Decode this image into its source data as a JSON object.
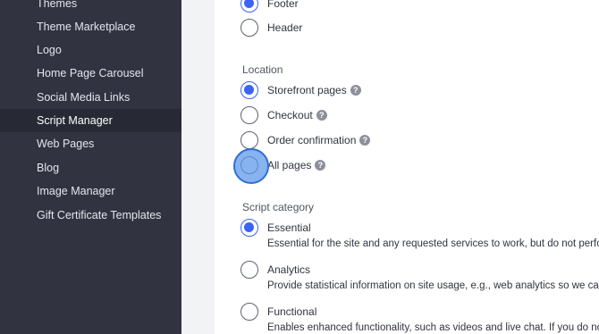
{
  "sidebar": {
    "items": [
      {
        "label": "Themes"
      },
      {
        "label": "Theme Marketplace"
      },
      {
        "label": "Logo"
      },
      {
        "label": "Home Page Carousel"
      },
      {
        "label": "Social Media Links"
      },
      {
        "label": "Script Manager",
        "active": true
      },
      {
        "label": "Web Pages"
      },
      {
        "label": "Blog"
      },
      {
        "label": "Image Manager"
      },
      {
        "label": "Gift Certificate Templates"
      }
    ]
  },
  "placement": {
    "options": [
      {
        "label": "Footer",
        "checked": true
      },
      {
        "label": "Header",
        "checked": false
      }
    ]
  },
  "location": {
    "title": "Location",
    "options": [
      {
        "label": "Storefront pages",
        "checked": true,
        "help": "?"
      },
      {
        "label": "Checkout",
        "checked": false,
        "help": "?"
      },
      {
        "label": "Order confirmation",
        "checked": false,
        "help": "?"
      },
      {
        "label": "All pages",
        "checked": false,
        "help": "?"
      }
    ]
  },
  "category": {
    "title": "Script category",
    "options": [
      {
        "label": "Essential",
        "checked": true,
        "desc": "Essential for the site and any requested services to work, but do not perform"
      },
      {
        "label": "Analytics",
        "checked": false,
        "desc": "Provide statistical information on site usage, e.g., web analytics so we can im"
      },
      {
        "label": "Functional",
        "checked": false,
        "desc": "Enables enhanced functionality, such as videos and live chat. If you do not al"
      }
    ]
  },
  "colors": {
    "sidebar_bg": "#313440",
    "sidebar_active_bg": "#272a34",
    "accent": "#3c64f4",
    "click_indicator": "#5a96eb"
  }
}
